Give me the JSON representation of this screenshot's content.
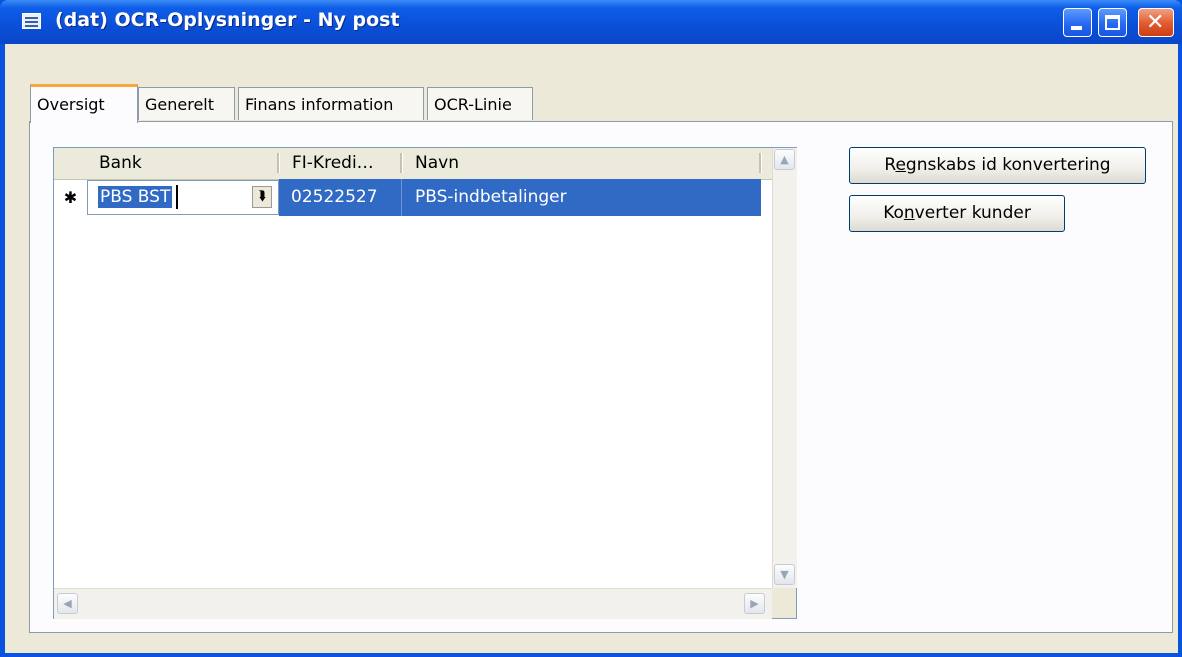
{
  "window": {
    "title": "(dat) OCR-Oplysninger - Ny post",
    "controls": [
      "minimize-icon",
      "maximize-icon",
      "close-icon"
    ]
  },
  "tabs": [
    {
      "label": "Oversigt",
      "active": true
    },
    {
      "label": "Generelt",
      "active": false
    },
    {
      "label": "Finans information",
      "active": false
    },
    {
      "label": "OCR-Linie",
      "active": false
    }
  ],
  "grid": {
    "columns": [
      "Bank",
      "FI-Kredi…",
      "Navn"
    ],
    "new_row_marker": "✱",
    "rows": [
      {
        "bank": "PBS BST",
        "fi_kreditor": "02522527",
        "navn": "PBS-indbetalinger"
      }
    ]
  },
  "buttons": {
    "regnskabs": {
      "pre": "R",
      "accel": "e",
      "post": "gnskabs id konvertering"
    },
    "konverter": {
      "pre": "Ko",
      "accel": "n",
      "post": "verter kunder"
    }
  },
  "colors": {
    "titlebar": "#0a4fd8",
    "selection": "#316ac5",
    "active_tab_accent": "#f5a83b",
    "dialog_face": "#ece9d8"
  }
}
